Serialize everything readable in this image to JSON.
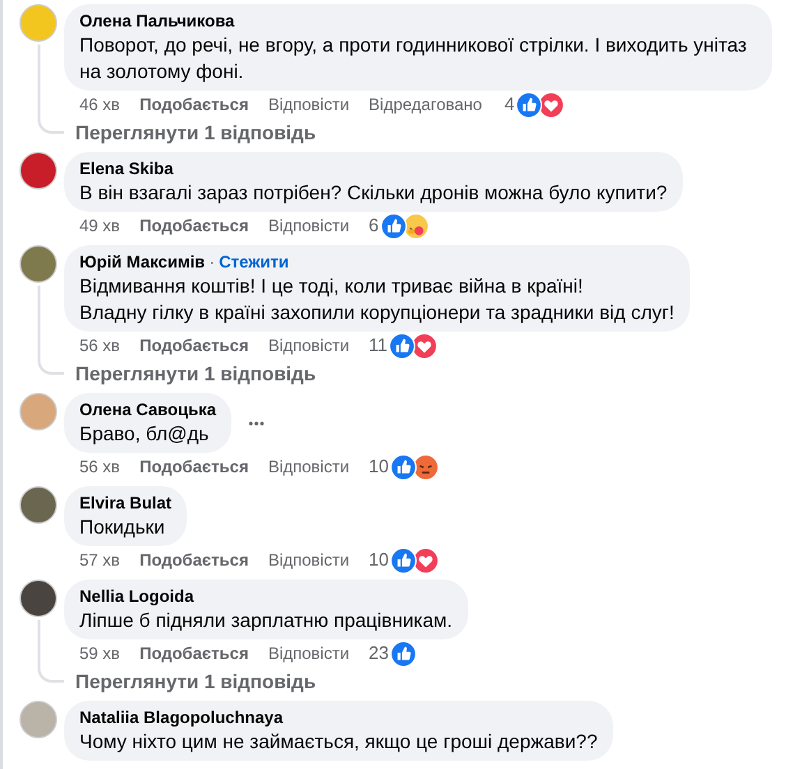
{
  "comments": [
    {
      "author": "Олена Пальчикова",
      "text": "Поворот, до речі, не вгору, а проти годинникової стрілки. І виходить унітаз на золотому фоні.",
      "time": "46 хв",
      "like": "Подобається",
      "reply": "Відповісти",
      "edited": "Відредаговано",
      "count": "4",
      "reactions": [
        {
          "kind": "like"
        },
        {
          "kind": "love"
        }
      ],
      "replies": "Переглянути 1 відповідь"
    },
    {
      "author": "Elena Skiba",
      "text": "В він взагалі зараз потрібен? Скільки дронів можна було купити?",
      "time": "49 хв",
      "like": "Подобається",
      "reply": "Відповісти",
      "count": "6",
      "reactions": [
        {
          "kind": "like"
        },
        {
          "kind": "care"
        }
      ]
    },
    {
      "author": "Юрій Максимів",
      "separator": "·",
      "follow": "Стежити",
      "text": "Відмивання коштів! І це тоді, коли триває війна в країні!\nВладну гілку в країні захопили корупціонери та зрадники від слуг!",
      "time": "56 хв",
      "like": "Подобається",
      "reply": "Відповісти",
      "count": "11",
      "reactions": [
        {
          "kind": "like"
        },
        {
          "kind": "love"
        }
      ],
      "replies": "Переглянути 1 відповідь"
    },
    {
      "author": "Олена Савоцька",
      "text": "Браво, бл@дь",
      "more_menu": true,
      "time": "56 хв",
      "like": "Подобається",
      "reply": "Відповісти",
      "count": "10",
      "reactions": [
        {
          "kind": "like"
        },
        {
          "kind": "angry"
        }
      ]
    },
    {
      "author": "Elvira Bulat",
      "text": "Покидьки",
      "time": "57 хв",
      "like": "Подобається",
      "reply": "Відповісти",
      "count": "10",
      "reactions": [
        {
          "kind": "like"
        },
        {
          "kind": "love"
        }
      ]
    },
    {
      "author": "Nellia Logoida",
      "text": "Ліпше б підняли зарплатню працівникам.",
      "time": "59 хв",
      "like": "Подобається",
      "reply": "Відповісти",
      "count": "23",
      "reactions": [
        {
          "kind": "like"
        }
      ],
      "replies": "Переглянути 1 відповідь"
    },
    {
      "author": "Nataliia Blagopoluchnaya",
      "text": "Чому ніхто цим не займається, якщо це гроші держави??"
    }
  ]
}
